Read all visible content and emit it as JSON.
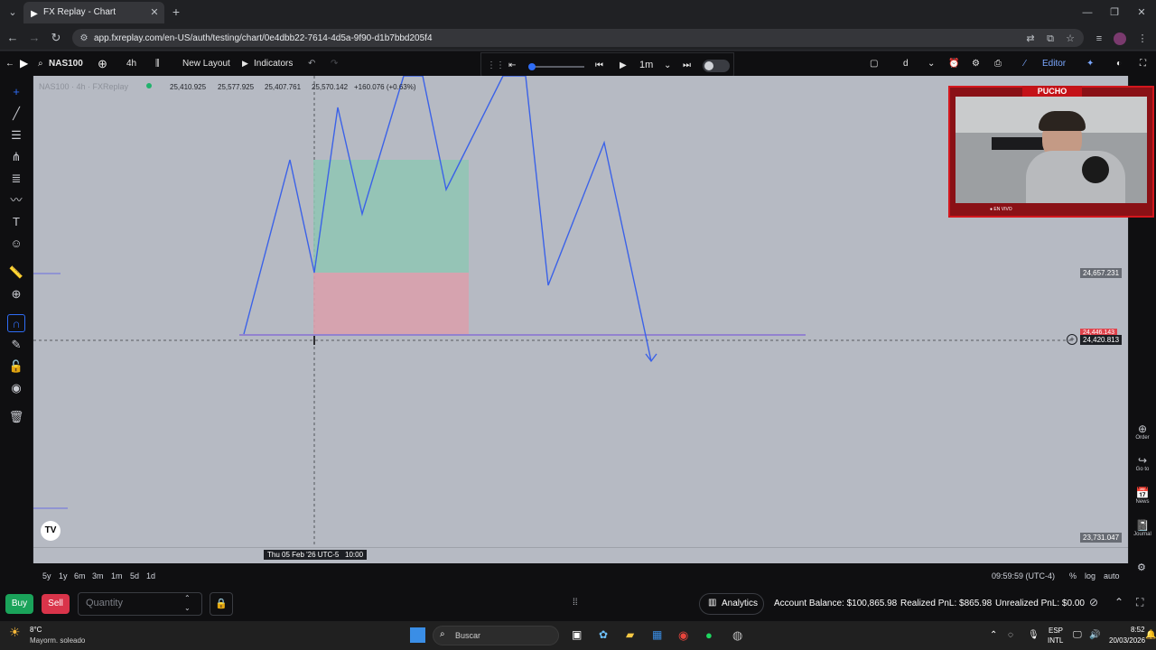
{
  "browser": {
    "tab_title": "FX Replay - Chart",
    "url": "app.fxreplay.com/en-US/auth/testing/chart/0e4dbb22-7614-4d5a-9f90-d1b7bbd205f4"
  },
  "toolbar": {
    "symbol": "NAS100",
    "timeframe": "4h",
    "new_layout": "New Layout",
    "indicators": "Indicators",
    "replay_speed": "1m",
    "chart_letter": "d",
    "editor": "Editor"
  },
  "legend": {
    "title": "NAS100 · 4h · FXReplay",
    "open": "25,410.925",
    "high": "25,577.925",
    "low": "25,407.761",
    "close": "25,570.142",
    "change": "+160.076 (+0.63%)"
  },
  "price_scale": {
    "p1": "24,657.231",
    "p2": "24,446.143",
    "p3": "24,420.813",
    "p4": "23,731.047"
  },
  "crosshair_time": "Thu 05 Feb '26 UTC-5",
  "crosshair_hour": "10:00",
  "timeframes": [
    "5y",
    "1y",
    "6m",
    "3m",
    "1m",
    "5d",
    "1d"
  ],
  "clock": "09:59:59 (UTC-4)",
  "scale_opts": {
    "percent": "%",
    "log": "log",
    "auto": "auto"
  },
  "right_tools": {
    "order": "Order",
    "goto": "Go to",
    "news": "News",
    "journal": "Journal"
  },
  "trade": {
    "buy": "Buy",
    "sell": "Sell",
    "quantity_placeholder": "Quantity",
    "analytics": "Analytics",
    "balance": "Account Balance: $100,865.98",
    "realized": "Realized PnL: $865.98",
    "unrealized": "Unrealized PnL: $0.00"
  },
  "webcam": {
    "name": "PUCHO",
    "live": "● EN VIVO"
  },
  "taskbar": {
    "temp": "8°C",
    "weather": "Mayorm. soleado",
    "search": "Buscar",
    "lang1": "ESP",
    "lang2": "INTL",
    "time": "8:52",
    "date": "20/03/2026"
  },
  "colors": {
    "line": "#3b62e8",
    "tp": "#8fc5b4",
    "sl": "#d9a1ad",
    "bg": "#b6bac3"
  }
}
